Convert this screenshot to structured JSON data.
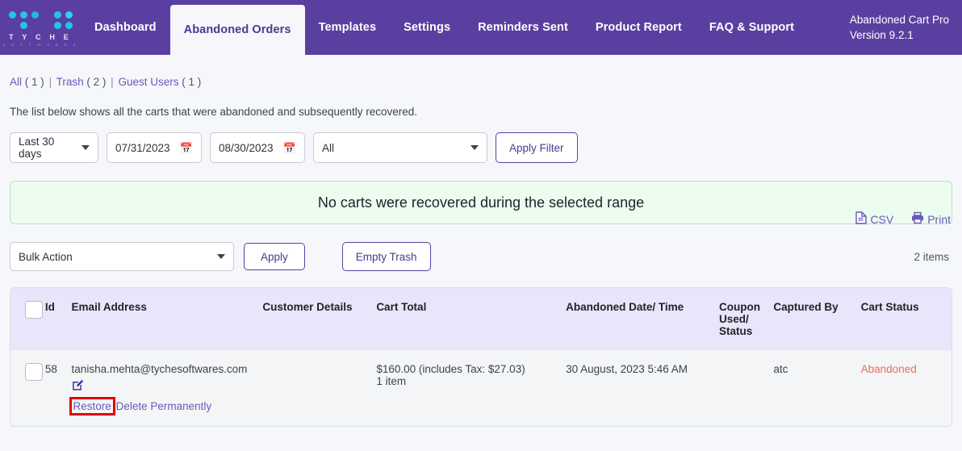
{
  "header": {
    "logo": {
      "word": "T Y C H E",
      "sub": "S O F T W A R E S",
      "dot_color": "#23c4ec",
      "dot_color_alt": "#1fb6e8"
    },
    "nav": [
      {
        "label": "Dashboard",
        "active": false
      },
      {
        "label": "Abandoned Orders",
        "active": true
      },
      {
        "label": "Templates",
        "active": false
      },
      {
        "label": "Settings",
        "active": false
      },
      {
        "label": "Reminders Sent",
        "active": false
      },
      {
        "label": "Product Report",
        "active": false
      },
      {
        "label": "FAQ & Support",
        "active": false
      }
    ],
    "product_name": "Abandoned Cart Pro",
    "product_version": "Version 9.2.1",
    "bar_color": "#5b3fa0"
  },
  "views": {
    "all_label": "All",
    "all_count": "( 1 )",
    "trash_label": "Trash",
    "trash_count": "( 2 )",
    "guest_label": "Guest Users",
    "guest_count": "( 1 )",
    "separator": "|"
  },
  "intro_text": "The list below shows all the carts that were abandoned and subsequently recovered.",
  "export": {
    "csv_label": "CSV",
    "print_label": "Print"
  },
  "filters": {
    "range_value": "Last 30 days",
    "date_from": "07/31/2023",
    "date_to": "08/30/2023",
    "status_value": "All",
    "apply_filter_label": "Apply Filter"
  },
  "notice": {
    "message": "No carts were recovered during the selected range",
    "bg": "#ecfcef",
    "border": "#b7e4c0"
  },
  "bulk": {
    "action_value": "Bulk Action",
    "apply_label": "Apply",
    "empty_trash_label": "Empty Trash",
    "items_count": "2 items"
  },
  "table": {
    "columns": [
      {
        "label": ""
      },
      {
        "label": "Id"
      },
      {
        "label": "Email Address"
      },
      {
        "label": "Customer Details"
      },
      {
        "label": "Cart Total"
      },
      {
        "label": "Abandoned Date/ Time"
      },
      {
        "label": "Coupon Used/ Status"
      },
      {
        "label": "Captured By"
      },
      {
        "label": "Cart Status"
      }
    ],
    "rows": [
      {
        "id": "58",
        "email": "tanisha.mehta@tychesoftwares.com",
        "edit_icon": "edit-icon",
        "actions": {
          "restore": "Restore",
          "delete": "Delete Permanently"
        },
        "customer_details": "",
        "cart_total": "$160.00 (includes Tax: $27.03)",
        "cart_items": "1 item",
        "abandoned_datetime": "30 August, 2023 5:46 AM",
        "coupon": "",
        "captured_by": "atc",
        "cart_status": "Abandoned",
        "cart_status_color": "#e8705a"
      }
    ]
  },
  "highlight": {
    "target": "restore-link",
    "color": "#e60000"
  }
}
